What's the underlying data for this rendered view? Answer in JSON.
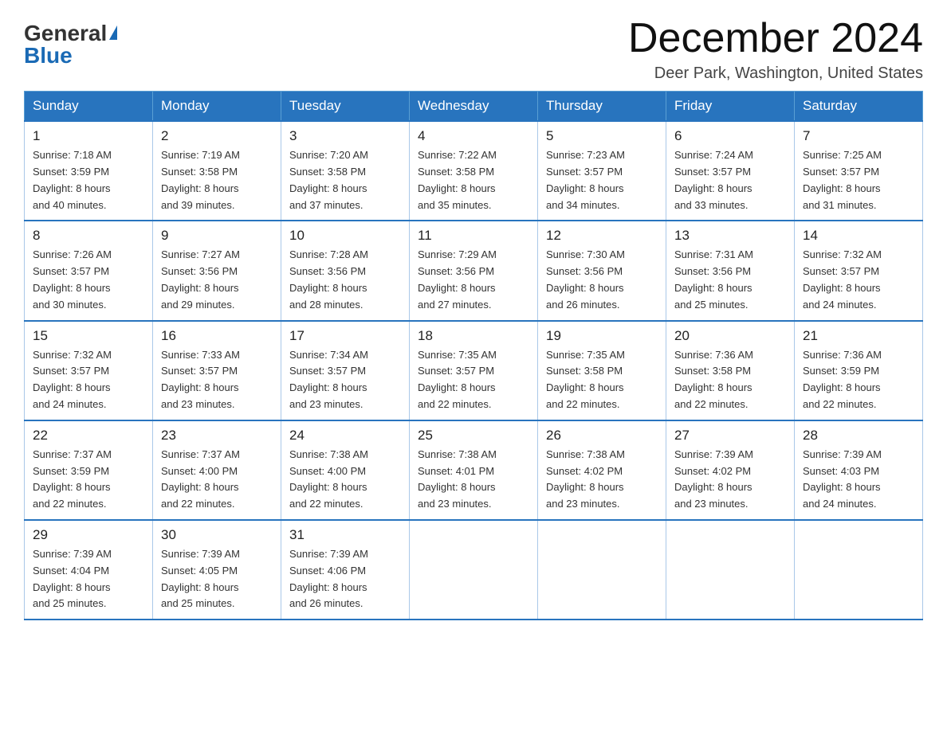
{
  "logo": {
    "general": "General",
    "blue": "Blue"
  },
  "title": "December 2024",
  "location": "Deer Park, Washington, United States",
  "weekdays": [
    "Sunday",
    "Monday",
    "Tuesday",
    "Wednesday",
    "Thursday",
    "Friday",
    "Saturday"
  ],
  "weeks": [
    [
      {
        "day": "1",
        "sunrise": "7:18 AM",
        "sunset": "3:59 PM",
        "daylight": "8 hours and 40 minutes."
      },
      {
        "day": "2",
        "sunrise": "7:19 AM",
        "sunset": "3:58 PM",
        "daylight": "8 hours and 39 minutes."
      },
      {
        "day": "3",
        "sunrise": "7:20 AM",
        "sunset": "3:58 PM",
        "daylight": "8 hours and 37 minutes."
      },
      {
        "day": "4",
        "sunrise": "7:22 AM",
        "sunset": "3:58 PM",
        "daylight": "8 hours and 35 minutes."
      },
      {
        "day": "5",
        "sunrise": "7:23 AM",
        "sunset": "3:57 PM",
        "daylight": "8 hours and 34 minutes."
      },
      {
        "day": "6",
        "sunrise": "7:24 AM",
        "sunset": "3:57 PM",
        "daylight": "8 hours and 33 minutes."
      },
      {
        "day": "7",
        "sunrise": "7:25 AM",
        "sunset": "3:57 PM",
        "daylight": "8 hours and 31 minutes."
      }
    ],
    [
      {
        "day": "8",
        "sunrise": "7:26 AM",
        "sunset": "3:57 PM",
        "daylight": "8 hours and 30 minutes."
      },
      {
        "day": "9",
        "sunrise": "7:27 AM",
        "sunset": "3:56 PM",
        "daylight": "8 hours and 29 minutes."
      },
      {
        "day": "10",
        "sunrise": "7:28 AM",
        "sunset": "3:56 PM",
        "daylight": "8 hours and 28 minutes."
      },
      {
        "day": "11",
        "sunrise": "7:29 AM",
        "sunset": "3:56 PM",
        "daylight": "8 hours and 27 minutes."
      },
      {
        "day": "12",
        "sunrise": "7:30 AM",
        "sunset": "3:56 PM",
        "daylight": "8 hours and 26 minutes."
      },
      {
        "day": "13",
        "sunrise": "7:31 AM",
        "sunset": "3:56 PM",
        "daylight": "8 hours and 25 minutes."
      },
      {
        "day": "14",
        "sunrise": "7:32 AM",
        "sunset": "3:57 PM",
        "daylight": "8 hours and 24 minutes."
      }
    ],
    [
      {
        "day": "15",
        "sunrise": "7:32 AM",
        "sunset": "3:57 PM",
        "daylight": "8 hours and 24 minutes."
      },
      {
        "day": "16",
        "sunrise": "7:33 AM",
        "sunset": "3:57 PM",
        "daylight": "8 hours and 23 minutes."
      },
      {
        "day": "17",
        "sunrise": "7:34 AM",
        "sunset": "3:57 PM",
        "daylight": "8 hours and 23 minutes."
      },
      {
        "day": "18",
        "sunrise": "7:35 AM",
        "sunset": "3:57 PM",
        "daylight": "8 hours and 22 minutes."
      },
      {
        "day": "19",
        "sunrise": "7:35 AM",
        "sunset": "3:58 PM",
        "daylight": "8 hours and 22 minutes."
      },
      {
        "day": "20",
        "sunrise": "7:36 AM",
        "sunset": "3:58 PM",
        "daylight": "8 hours and 22 minutes."
      },
      {
        "day": "21",
        "sunrise": "7:36 AM",
        "sunset": "3:59 PM",
        "daylight": "8 hours and 22 minutes."
      }
    ],
    [
      {
        "day": "22",
        "sunrise": "7:37 AM",
        "sunset": "3:59 PM",
        "daylight": "8 hours and 22 minutes."
      },
      {
        "day": "23",
        "sunrise": "7:37 AM",
        "sunset": "4:00 PM",
        "daylight": "8 hours and 22 minutes."
      },
      {
        "day": "24",
        "sunrise": "7:38 AM",
        "sunset": "4:00 PM",
        "daylight": "8 hours and 22 minutes."
      },
      {
        "day": "25",
        "sunrise": "7:38 AM",
        "sunset": "4:01 PM",
        "daylight": "8 hours and 23 minutes."
      },
      {
        "day": "26",
        "sunrise": "7:38 AM",
        "sunset": "4:02 PM",
        "daylight": "8 hours and 23 minutes."
      },
      {
        "day": "27",
        "sunrise": "7:39 AM",
        "sunset": "4:02 PM",
        "daylight": "8 hours and 23 minutes."
      },
      {
        "day": "28",
        "sunrise": "7:39 AM",
        "sunset": "4:03 PM",
        "daylight": "8 hours and 24 minutes."
      }
    ],
    [
      {
        "day": "29",
        "sunrise": "7:39 AM",
        "sunset": "4:04 PM",
        "daylight": "8 hours and 25 minutes."
      },
      {
        "day": "30",
        "sunrise": "7:39 AM",
        "sunset": "4:05 PM",
        "daylight": "8 hours and 25 minutes."
      },
      {
        "day": "31",
        "sunrise": "7:39 AM",
        "sunset": "4:06 PM",
        "daylight": "8 hours and 26 minutes."
      },
      null,
      null,
      null,
      null
    ]
  ],
  "labels": {
    "sunrise": "Sunrise:",
    "sunset": "Sunset:",
    "daylight": "Daylight:"
  }
}
